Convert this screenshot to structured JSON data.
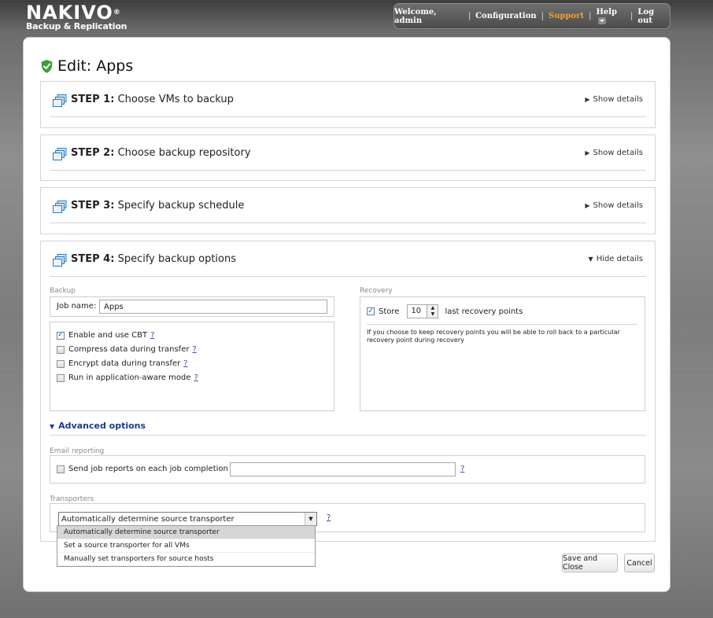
{
  "header": {
    "brand": "NAKIVO",
    "brand_mark": "®",
    "product": "Backup & Replication",
    "nav": {
      "welcome": "Welcome, admin",
      "configuration": "Configuration",
      "support": "Support",
      "help": "Help",
      "logout": "Log out",
      "separator": "|"
    },
    "support_color": "#f7a21b"
  },
  "page": {
    "title": "Edit: Apps",
    "title_icon": "shield-check-icon"
  },
  "steps": [
    {
      "number": "STEP 1:",
      "label": "Choose VMs to backup",
      "toggle": "Show details",
      "icon": "vm-stack-icon"
    },
    {
      "number": "STEP 2:",
      "label": "Choose backup repository",
      "toggle": "Show details",
      "icon": "vm-stack-icon"
    },
    {
      "number": "STEP 3:",
      "label": "Specify backup schedule",
      "toggle": "Show details",
      "icon": "vm-stack-icon"
    },
    {
      "number": "STEP 4:",
      "label": "Specify backup options",
      "toggle": "Hide details",
      "icon": "vm-stack-icon"
    }
  ],
  "backup": {
    "section_label": "Backup",
    "job_name_label": "Job name:",
    "job_name_value": "Apps",
    "options": [
      {
        "label": "Enable and use CBT",
        "checked": true,
        "help": "?"
      },
      {
        "label": "Compress data during transfer",
        "checked": false,
        "help": "?"
      },
      {
        "label": "Encrypt data during transfer",
        "checked": false,
        "help": "?"
      },
      {
        "label": "Run in application-aware mode",
        "checked": false,
        "help": "?"
      }
    ]
  },
  "recovery": {
    "section_label": "Recovery",
    "store_label": "Store",
    "store_checked": true,
    "store_value": "10",
    "points_label": "last recovery points",
    "note": "If you choose to keep recovery points you will be able to roll back to a particular recovery point during recovery"
  },
  "advanced": {
    "label": "Advanced options"
  },
  "email": {
    "section_label": "Email reporting",
    "send_label": "Send job reports on each job completion to:",
    "send_checked": false,
    "address_value": "",
    "help": "?"
  },
  "transporters": {
    "section_label": "Transporters",
    "selected": "Automatically determine source transporter",
    "help": "?",
    "options": [
      "Automatically determine source transporter",
      "Set a source transporter for all VMs",
      "Manually set transporters for source hosts"
    ]
  },
  "actions": {
    "save": "Save and Close",
    "cancel": "Cancel"
  },
  "accent_colors": {
    "link_blue": "#1e3a8a",
    "shield_green": "#3aa335",
    "step_icon_blue": "#2d7cc1"
  }
}
